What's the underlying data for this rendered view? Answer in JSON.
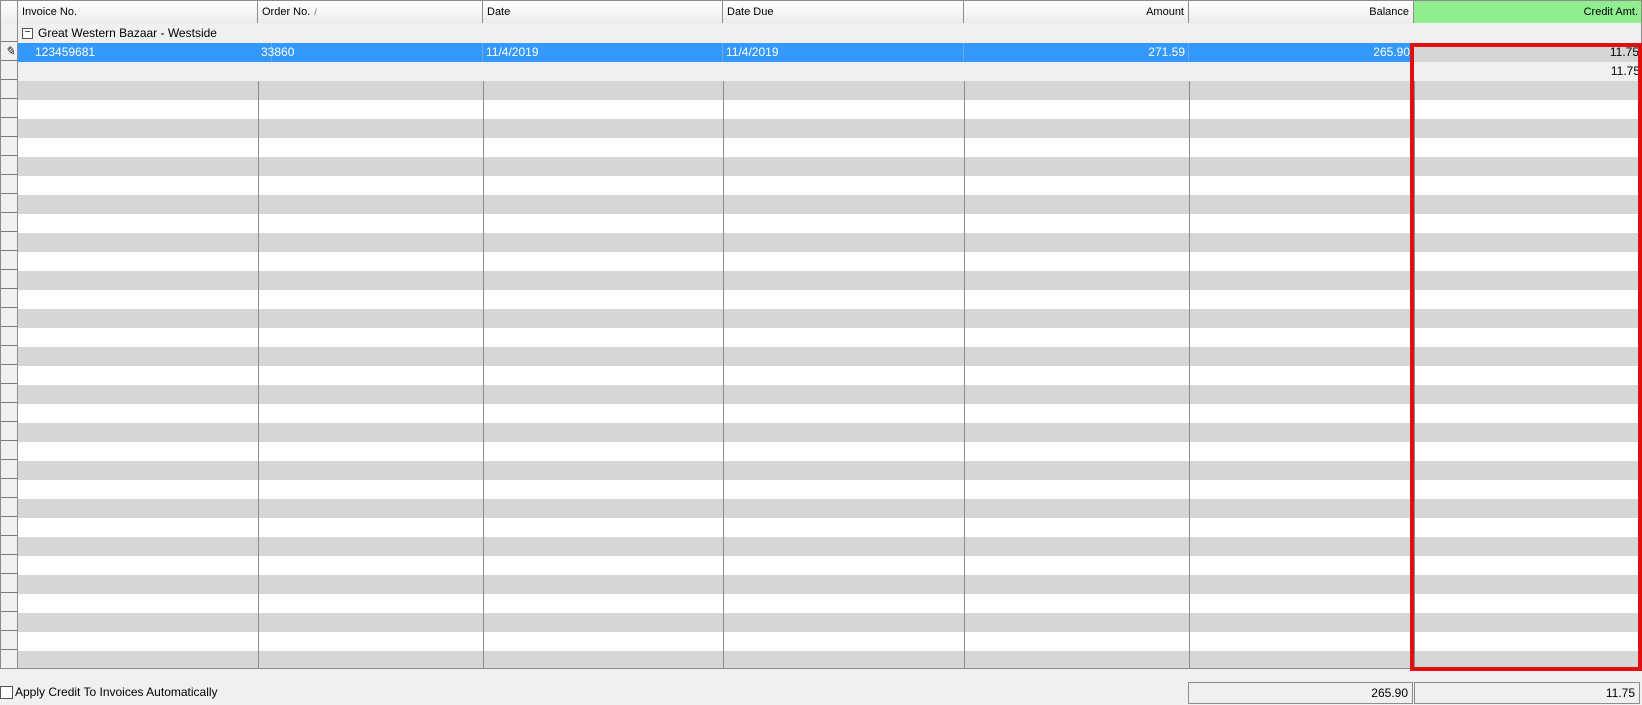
{
  "columns": [
    {
      "label": "Invoice No."
    },
    {
      "label": "Order No.",
      "sort_indicator": "/"
    },
    {
      "label": "Date"
    },
    {
      "label": "Date Due"
    },
    {
      "label": "Amount"
    },
    {
      "label": "Balance"
    },
    {
      "label": "Credit Amt."
    }
  ],
  "group": {
    "toggle": "−",
    "label": "Great Western Bazaar - Westside"
  },
  "rows": [
    {
      "invoice_no": "123459681",
      "order_no": "33860",
      "date": "11/4/2019",
      "date_due": "11/4/2019",
      "amount": "271.59",
      "balance": "265.90",
      "credit_amt": "11.75"
    }
  ],
  "group_total": {
    "credit_amt": "11.75"
  },
  "footer": {
    "apply_credit_label": "Apply Credit To Invoices Automatically",
    "apply_credit_checked": false,
    "total_balance": "265.90",
    "total_credit": "11.75"
  },
  "colors": {
    "selected_row": "#3399ff",
    "credit_header": "#90ee90",
    "highlight_border": "#e01010"
  }
}
